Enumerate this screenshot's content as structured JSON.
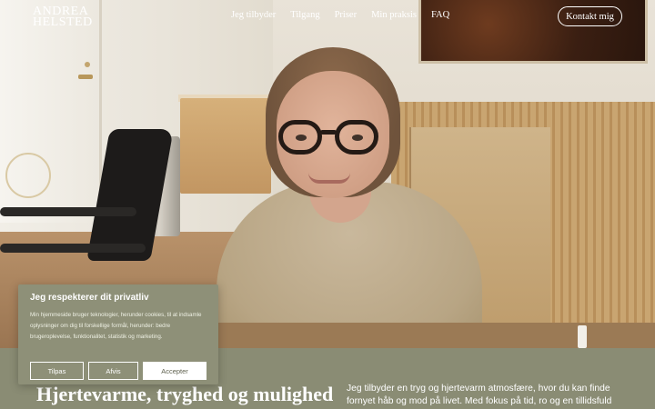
{
  "header": {
    "logo_line1": "ANDREA",
    "logo_line2": "HELSTED",
    "nav": [
      "Jeg tilbyder",
      "Tilgang",
      "Priser",
      "Min praksis",
      "FAQ"
    ],
    "contact_label": "Kontakt mig"
  },
  "hero": {
    "image": "portrait-photo"
  },
  "main": {
    "headline": "Hjertevarme, tryghed og mulighed",
    "intro": "Jeg tilbyder en tryg og hjertevarm atmosfære, hvor du kan finde fornyet håb og mod på livet. Med fokus på tid, ro og en tillidsfuld"
  },
  "cookie": {
    "title": "Jeg respekterer dit privatliv",
    "body": "Min hjemmeside bruger teknologier, herunder cookies, til at indsamle oplysninger om dig til forskellige formål, herunder: bedre brugeroplevelse, funktionalitet, statistik og marketing.",
    "adjust_label": "Tilpas",
    "reject_label": "Afvis",
    "accept_label": "Accepter"
  },
  "colors": {
    "band": "#8a8c74",
    "cookie_bg": "#8e9078",
    "accept_text": "#5d5f4c"
  }
}
